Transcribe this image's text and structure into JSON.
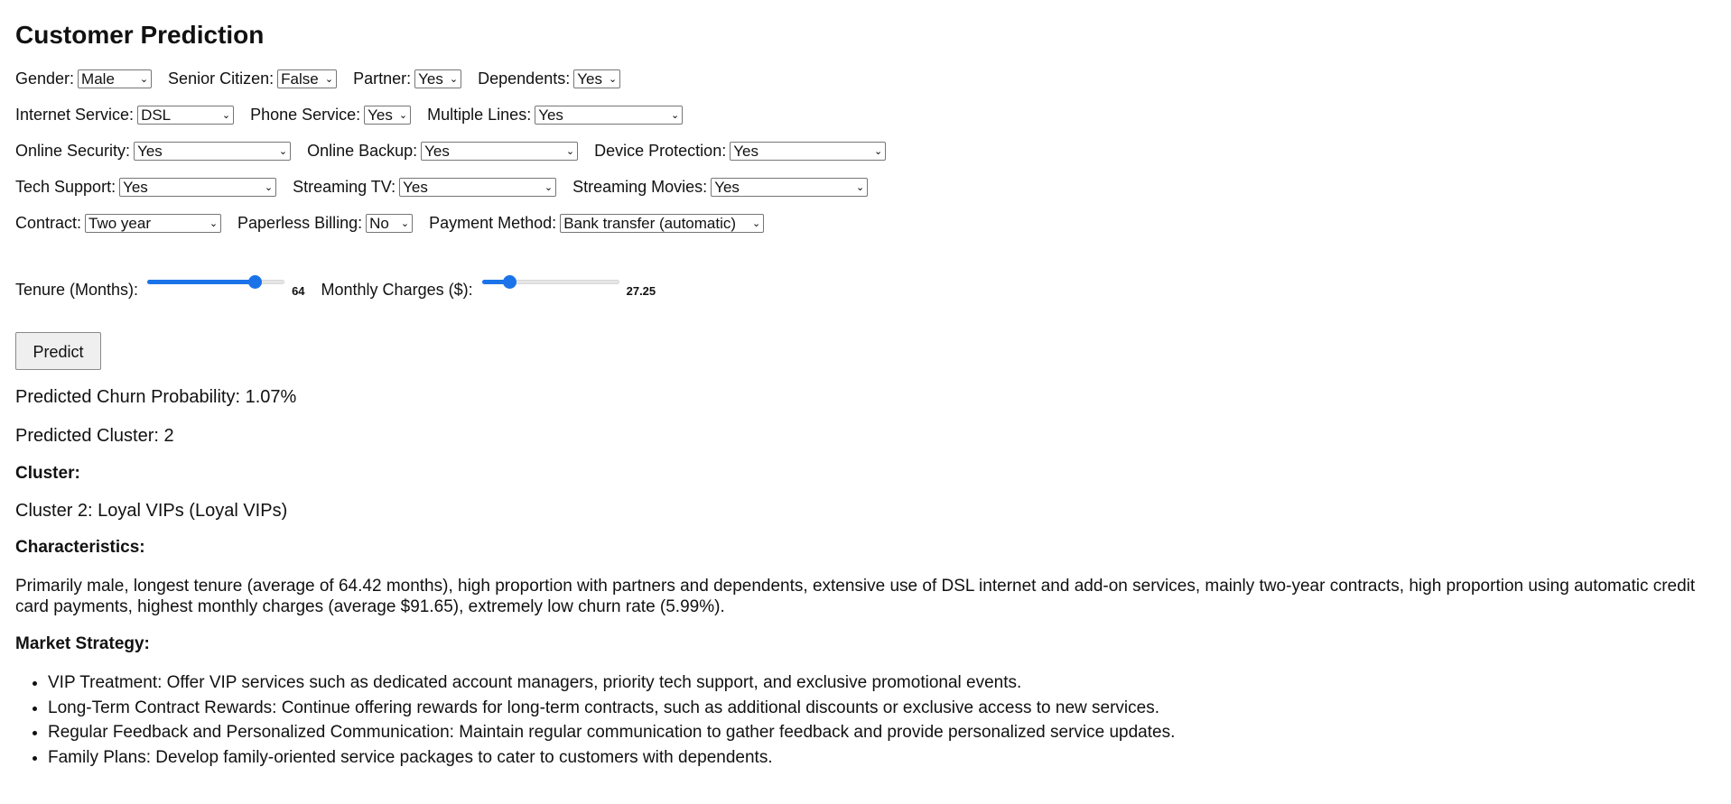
{
  "page_title": "Customer Prediction",
  "form": {
    "gender": {
      "label": "Gender:",
      "value": "Male"
    },
    "senior_citizen": {
      "label": "Senior Citizen:",
      "value": "False"
    },
    "partner": {
      "label": "Partner:",
      "value": "Yes"
    },
    "dependents": {
      "label": "Dependents:",
      "value": "Yes"
    },
    "internet_service": {
      "label": "Internet Service:",
      "value": "DSL"
    },
    "phone_service": {
      "label": "Phone Service:",
      "value": "Yes"
    },
    "multiple_lines": {
      "label": "Multiple Lines:",
      "value": "Yes"
    },
    "online_security": {
      "label": "Online Security:",
      "value": "Yes"
    },
    "online_backup": {
      "label": "Online Backup:",
      "value": "Yes"
    },
    "device_protection": {
      "label": "Device Protection:",
      "value": "Yes"
    },
    "tech_support": {
      "label": "Tech Support:",
      "value": "Yes"
    },
    "streaming_tv": {
      "label": "Streaming TV:",
      "value": "Yes"
    },
    "streaming_movies": {
      "label": "Streaming Movies:",
      "value": "Yes"
    },
    "contract": {
      "label": "Contract:",
      "value": "Two year"
    },
    "paperless_billing": {
      "label": "Paperless Billing:",
      "value": "No"
    },
    "payment_method": {
      "label": "Payment Method:",
      "value": "Bank transfer (automatic)"
    },
    "tenure": {
      "label": "Tenure (Months):",
      "value": "64",
      "fraction": 0.78
    },
    "monthly_charges": {
      "label": "Monthly Charges ($):",
      "value": "27.25",
      "fraction": 0.2
    }
  },
  "predict_button": "Predict",
  "results": {
    "churn_probability": "Predicted Churn Probability: 1.07%",
    "predicted_cluster": "Predicted Cluster: 2",
    "cluster_heading": "Cluster:",
    "cluster_name": "Cluster 2: Loyal VIPs (Loyal VIPs)",
    "characteristics_heading": "Characteristics:",
    "characteristics_text": "Primarily male, longest tenure (average of 64.42 months), high proportion with partners and dependents, extensive use of DSL internet and add-on services, mainly two-year contracts, high proportion using automatic credit card payments, highest monthly charges (average $91.65), extremely low churn rate (5.99%).",
    "strategy_heading": "Market Strategy:",
    "strategy_items": [
      "VIP Treatment: Offer VIP services such as dedicated account managers, priority tech support, and exclusive promotional events.",
      "Long-Term Contract Rewards: Continue offering rewards for long-term contracts, such as additional discounts or exclusive access to new services.",
      "Regular Feedback and Personalized Communication: Maintain regular communication to gather feedback and provide personalized service updates.",
      "Family Plans: Develop family-oriented service packages to cater to customers with dependents."
    ]
  },
  "colors": {
    "accent": "#1a73e8"
  }
}
